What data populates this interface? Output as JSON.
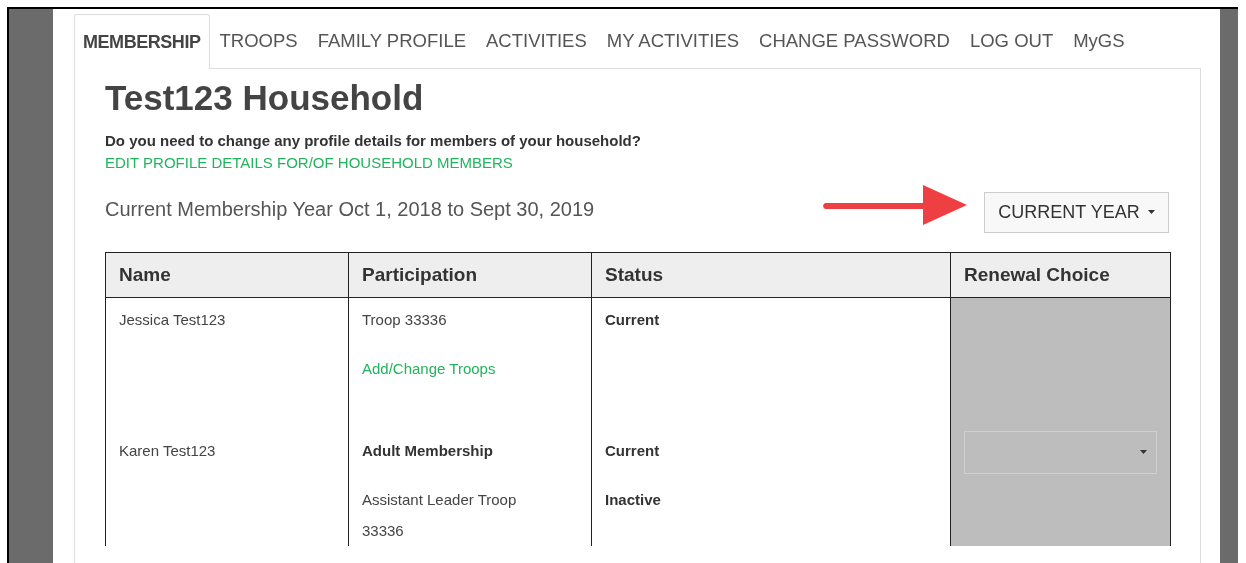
{
  "tabs": [
    {
      "label": "MEMBERSHIP",
      "selected": true
    },
    {
      "label": "TROOPS",
      "selected": false
    },
    {
      "label": "FAMILY PROFILE",
      "selected": false
    },
    {
      "label": "ACTIVITIES",
      "selected": false
    },
    {
      "label": "MY ACTIVITIES",
      "selected": false
    },
    {
      "label": "CHANGE PASSWORD",
      "selected": false
    },
    {
      "label": "LOG OUT",
      "selected": false
    },
    {
      "label": "MyGS",
      "selected": false
    }
  ],
  "title": "Test123 Household",
  "question": "Do you need to change any profile details for members of your household?",
  "edit_link": "EDIT PROFILE DETAILS FOR/OF HOUSEHOLD MEMBERS",
  "membership_year": "Current Membership Year Oct 1, 2018 to Sept 30, 2019",
  "year_dropdown": {
    "value": "CURRENT YEAR"
  },
  "table": {
    "columns": [
      "Name",
      "Participation",
      "Status",
      "Renewal Choice"
    ],
    "rows": [
      {
        "name": "Jessica Test123",
        "participation": [
          {
            "kind": "text",
            "text": "Troop 33336"
          },
          {
            "kind": "link",
            "text": "Add/Change Troops"
          }
        ],
        "status": [
          "Current"
        ],
        "renewal_dropdown": false
      },
      {
        "name": "Karen Test123",
        "participation": [
          {
            "kind": "bold",
            "text": "Adult Membership"
          },
          {
            "kind": "text",
            "text": "Assistant Leader Troop 33336"
          }
        ],
        "status": [
          "Current",
          "Inactive"
        ],
        "renewal_dropdown": true
      }
    ]
  }
}
